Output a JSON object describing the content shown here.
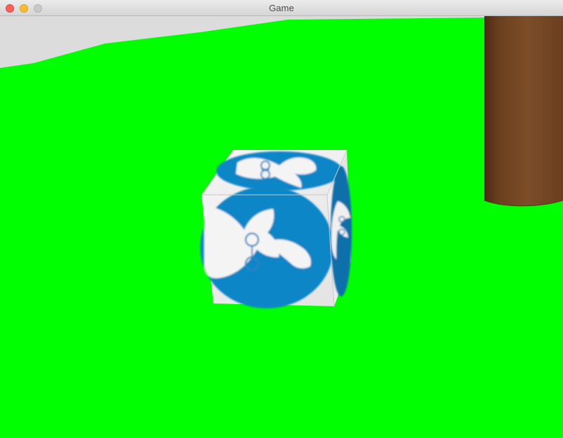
{
  "window": {
    "title": "Game",
    "controls": [
      "close",
      "minimize",
      "maximize"
    ]
  },
  "scene": {
    "objects": [
      {
        "name": "ground-plane",
        "color": "#00ff00"
      },
      {
        "name": "sky-background",
        "color": "#dcdcdc"
      },
      {
        "name": "wooden-pillar",
        "color": "#7a4a25"
      },
      {
        "name": "textured-cube",
        "texture": "blue-circle-bunny-logo",
        "accent": "#0a86c8"
      }
    ]
  }
}
